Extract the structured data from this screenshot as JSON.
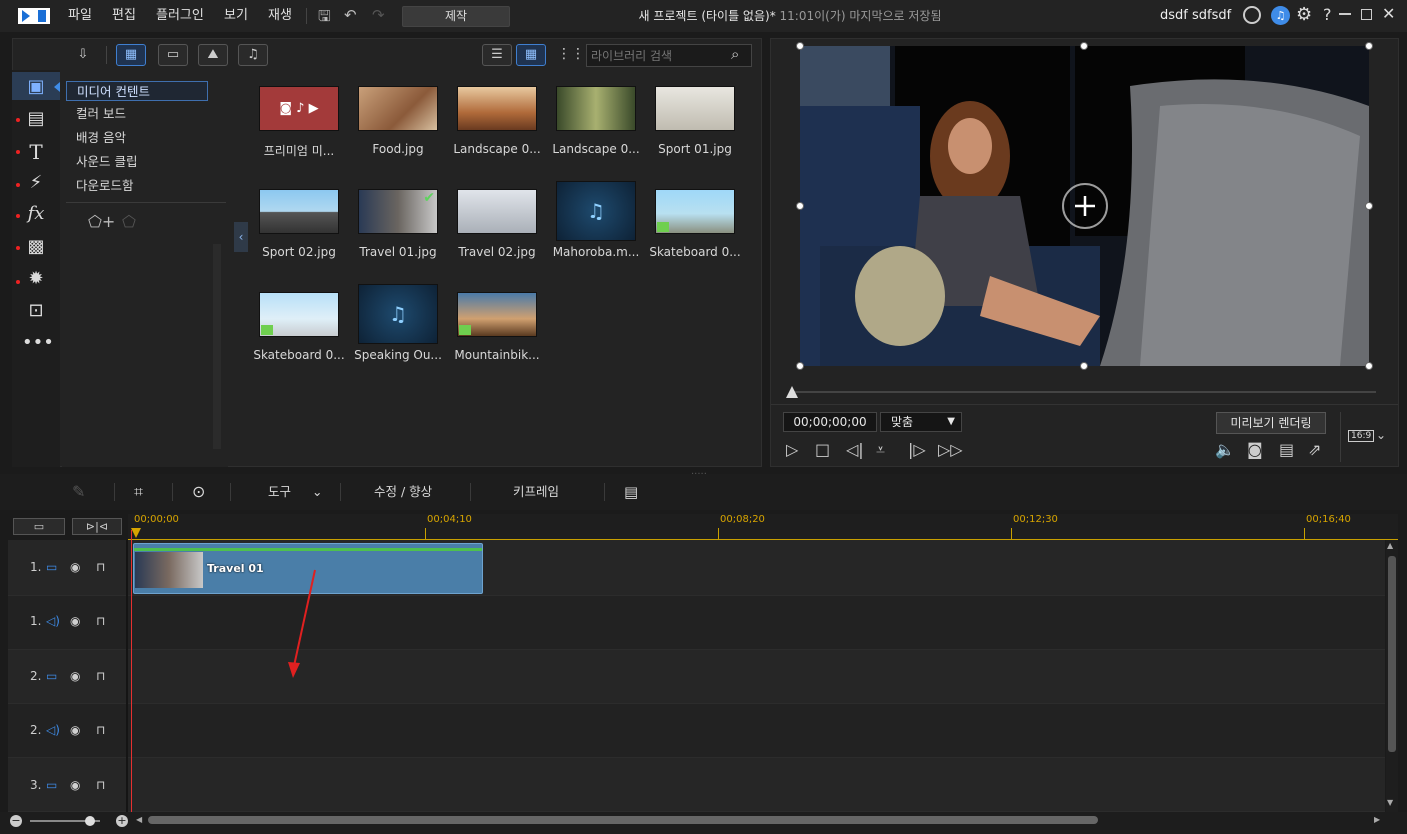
{
  "titlebar": {
    "menus": [
      "파일",
      "편집",
      "플러그인",
      "보기",
      "재생"
    ],
    "produce": "제작",
    "doc_title": "새 프로젝트 (타이틀 없음)*",
    "saved_status": "11:01이(가) 마지막으로 저장됨",
    "user": "dsdf sdfsdf"
  },
  "library": {
    "categories": [
      "미디어 컨텐트",
      "컬러 보드",
      "배경 음악",
      "사운드 클립",
      "다운로드함"
    ],
    "search_placeholder": "라이브러리 검색",
    "items": [
      {
        "label": "프리미엄 미..."
      },
      {
        "label": "Food.jpg"
      },
      {
        "label": "Landscape 0..."
      },
      {
        "label": "Landscape 0..."
      },
      {
        "label": "Sport 01.jpg"
      },
      {
        "label": "Sport 02.jpg"
      },
      {
        "label": "Travel 01.jpg"
      },
      {
        "label": "Travel 02.jpg"
      },
      {
        "label": "Mahoroba.m..."
      },
      {
        "label": "Skateboard 0..."
      },
      {
        "label": "Skateboard 0..."
      },
      {
        "label": "Speaking Ou..."
      },
      {
        "label": "Mountainbik..."
      }
    ]
  },
  "preview": {
    "timecode": "00;00;00;00",
    "fit": "맞춤",
    "render": "미리보기 렌더링",
    "aspect": "16:9"
  },
  "timeline_toolbar": {
    "tools": "도구",
    "fix": "수정 / 향상",
    "keyframe": "키프레임"
  },
  "timeline": {
    "ticks": [
      "00;00;00",
      "00;04;10",
      "00;08;20",
      "00;12;30",
      "00;16;40"
    ],
    "tracks": [
      {
        "label": "1."
      },
      {
        "label": "1."
      },
      {
        "label": "2."
      },
      {
        "label": "2."
      },
      {
        "label": "3."
      }
    ],
    "clip_title": "Travel 01"
  },
  "colors": {
    "accent": "#3f7fd0",
    "clip": "#4a7ea8",
    "playhead": "#e53030"
  }
}
